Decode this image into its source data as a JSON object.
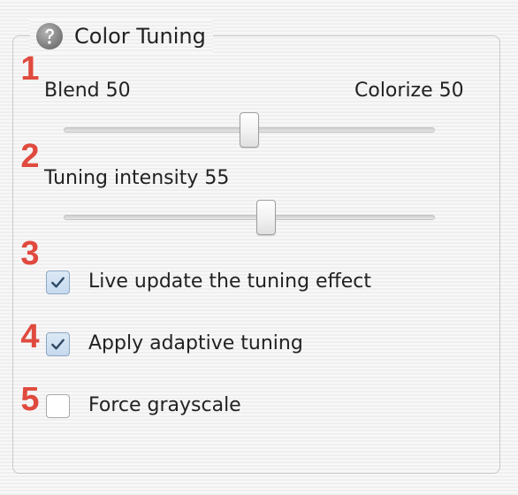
{
  "panel": {
    "title": "Color Tuning",
    "help_icon": "help-icon"
  },
  "step_numbers": [
    "1",
    "2",
    "3",
    "4",
    "5"
  ],
  "blend_slider": {
    "left_label": "Blend 50",
    "right_label": "Colorize 50",
    "value": 50,
    "min": 0,
    "max": 100
  },
  "intensity_slider": {
    "label": "Tuning intensity 55",
    "value": 55,
    "min": 0,
    "max": 100
  },
  "checkboxes": [
    {
      "label": "Live update the tuning effect",
      "checked": true
    },
    {
      "label": "Apply adaptive tuning",
      "checked": true
    },
    {
      "label": "Force grayscale",
      "checked": false
    }
  ],
  "colors": {
    "step_number": "#e04a3e",
    "checked_fill": "#c6daee",
    "check_mark": "#2f4a66"
  }
}
